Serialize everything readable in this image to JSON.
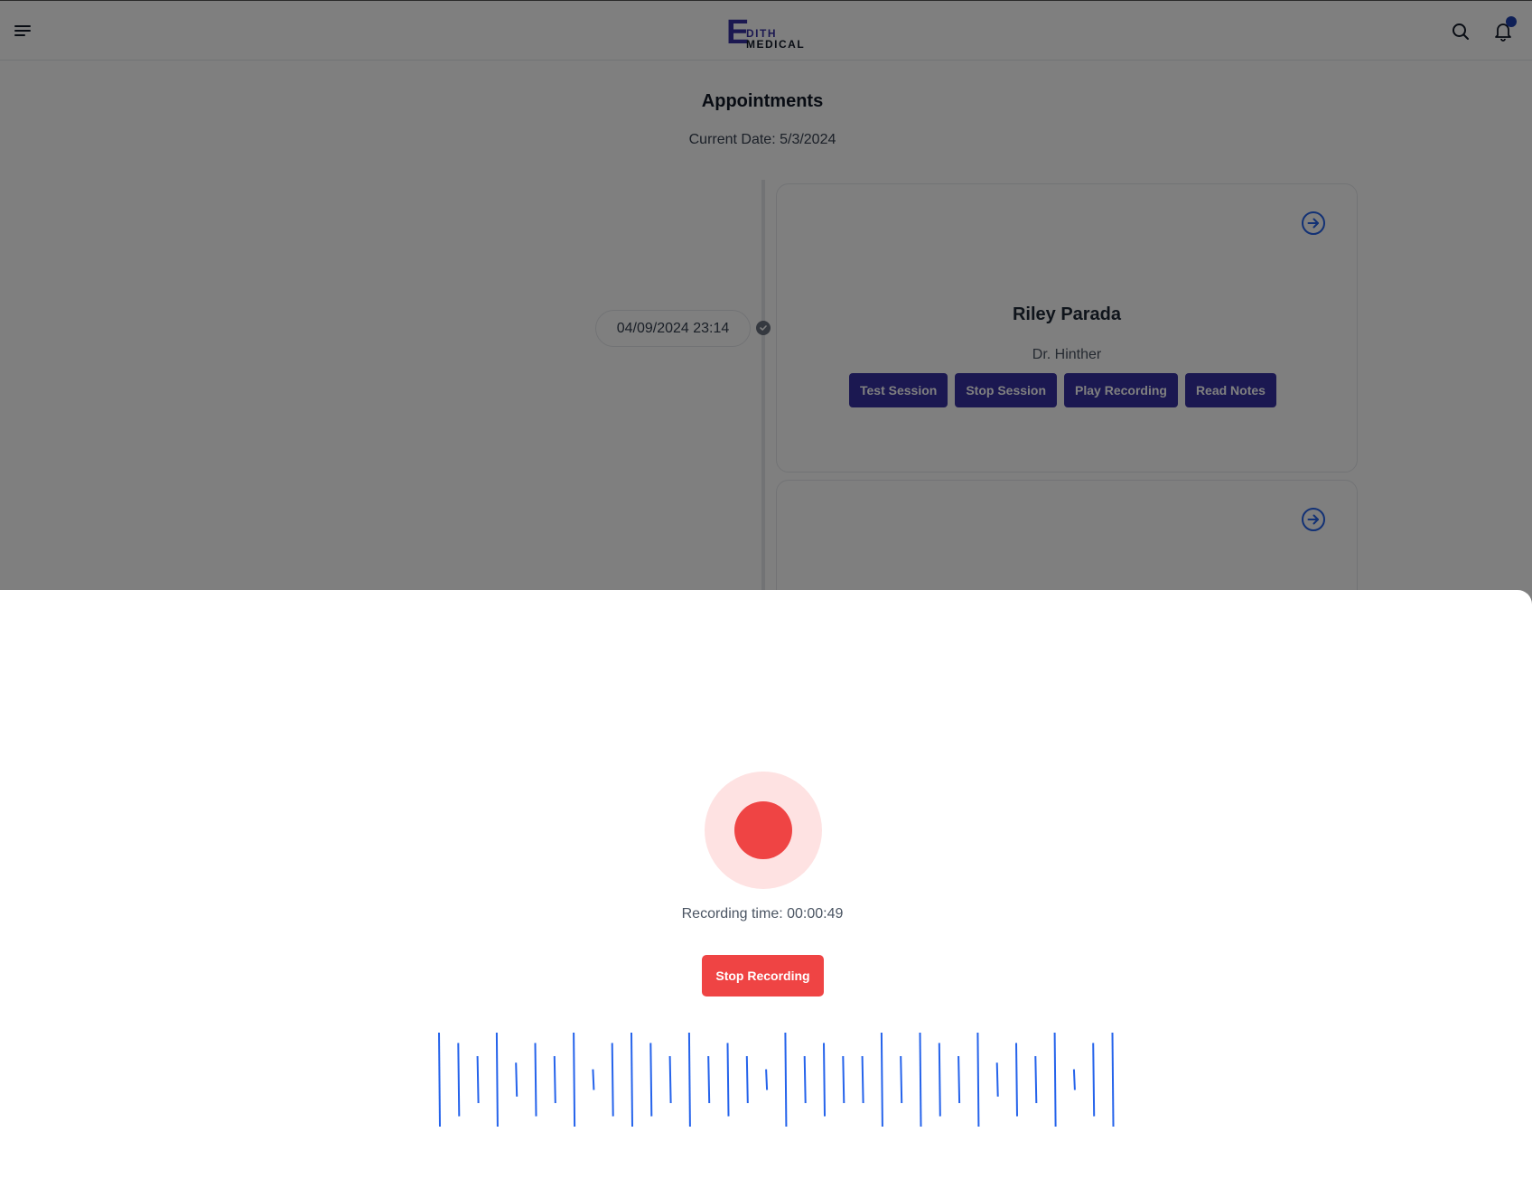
{
  "header": {
    "logo_letter": "E",
    "logo_line1": "DITH",
    "logo_line2": "MEDICAL"
  },
  "page": {
    "title": "Appointments",
    "current_date": "Current Date: 5/3/2024"
  },
  "appointments": [
    {
      "datetime": "04/09/2024 23:14",
      "patient": "Riley Parada",
      "doctor": "Dr. Hinther",
      "buttons": [
        "Test Session",
        "Stop Session",
        "Play Recording",
        "Read Notes"
      ]
    }
  ],
  "recorder": {
    "time_text": "Recording time: 00:00:49",
    "stop_label": "Stop Recording",
    "waveform_levels": [
      1.0,
      0.78,
      0.5,
      1.0,
      0.36,
      0.78,
      0.5,
      1.0,
      0.22,
      0.78,
      1.0,
      0.78,
      0.5,
      1.0,
      0.5,
      0.78,
      0.5,
      0.22,
      1.0,
      0.5,
      0.78,
      0.5,
      0.5,
      1.0,
      0.5,
      1.0,
      0.78,
      0.5,
      1.0,
      0.36,
      0.78,
      0.5,
      1.0,
      0.22,
      0.78,
      1.0
    ]
  },
  "colors": {
    "brand": "#3730a3",
    "record_red": "#ef4444",
    "wave_blue": "#2563eb",
    "notification_dot": "#1e40af"
  },
  "icons": {
    "menu": "menu-icon",
    "search": "search-icon",
    "bell": "bell-icon",
    "arrow": "arrow-right-circle-icon",
    "check": "check-circle-icon"
  }
}
